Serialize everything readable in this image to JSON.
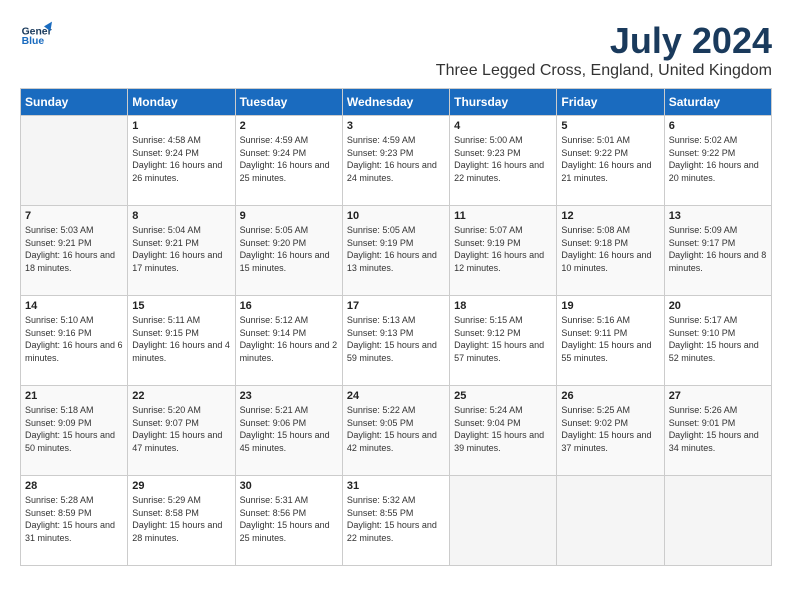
{
  "header": {
    "logo_line1": "General",
    "logo_line2": "Blue",
    "month_title": "July 2024",
    "location": "Three Legged Cross, England, United Kingdom"
  },
  "days_of_week": [
    "Sunday",
    "Monday",
    "Tuesday",
    "Wednesday",
    "Thursday",
    "Friday",
    "Saturday"
  ],
  "weeks": [
    [
      {
        "day": "",
        "sunrise": "",
        "sunset": "",
        "daylight": ""
      },
      {
        "day": "1",
        "sunrise": "Sunrise: 4:58 AM",
        "sunset": "Sunset: 9:24 PM",
        "daylight": "Daylight: 16 hours and 26 minutes."
      },
      {
        "day": "2",
        "sunrise": "Sunrise: 4:59 AM",
        "sunset": "Sunset: 9:24 PM",
        "daylight": "Daylight: 16 hours and 25 minutes."
      },
      {
        "day": "3",
        "sunrise": "Sunrise: 4:59 AM",
        "sunset": "Sunset: 9:23 PM",
        "daylight": "Daylight: 16 hours and 24 minutes."
      },
      {
        "day": "4",
        "sunrise": "Sunrise: 5:00 AM",
        "sunset": "Sunset: 9:23 PM",
        "daylight": "Daylight: 16 hours and 22 minutes."
      },
      {
        "day": "5",
        "sunrise": "Sunrise: 5:01 AM",
        "sunset": "Sunset: 9:22 PM",
        "daylight": "Daylight: 16 hours and 21 minutes."
      },
      {
        "day": "6",
        "sunrise": "Sunrise: 5:02 AM",
        "sunset": "Sunset: 9:22 PM",
        "daylight": "Daylight: 16 hours and 20 minutes."
      }
    ],
    [
      {
        "day": "7",
        "sunrise": "Sunrise: 5:03 AM",
        "sunset": "Sunset: 9:21 PM",
        "daylight": "Daylight: 16 hours and 18 minutes."
      },
      {
        "day": "8",
        "sunrise": "Sunrise: 5:04 AM",
        "sunset": "Sunset: 9:21 PM",
        "daylight": "Daylight: 16 hours and 17 minutes."
      },
      {
        "day": "9",
        "sunrise": "Sunrise: 5:05 AM",
        "sunset": "Sunset: 9:20 PM",
        "daylight": "Daylight: 16 hours and 15 minutes."
      },
      {
        "day": "10",
        "sunrise": "Sunrise: 5:05 AM",
        "sunset": "Sunset: 9:19 PM",
        "daylight": "Daylight: 16 hours and 13 minutes."
      },
      {
        "day": "11",
        "sunrise": "Sunrise: 5:07 AM",
        "sunset": "Sunset: 9:19 PM",
        "daylight": "Daylight: 16 hours and 12 minutes."
      },
      {
        "day": "12",
        "sunrise": "Sunrise: 5:08 AM",
        "sunset": "Sunset: 9:18 PM",
        "daylight": "Daylight: 16 hours and 10 minutes."
      },
      {
        "day": "13",
        "sunrise": "Sunrise: 5:09 AM",
        "sunset": "Sunset: 9:17 PM",
        "daylight": "Daylight: 16 hours and 8 minutes."
      }
    ],
    [
      {
        "day": "14",
        "sunrise": "Sunrise: 5:10 AM",
        "sunset": "Sunset: 9:16 PM",
        "daylight": "Daylight: 16 hours and 6 minutes."
      },
      {
        "day": "15",
        "sunrise": "Sunrise: 5:11 AM",
        "sunset": "Sunset: 9:15 PM",
        "daylight": "Daylight: 16 hours and 4 minutes."
      },
      {
        "day": "16",
        "sunrise": "Sunrise: 5:12 AM",
        "sunset": "Sunset: 9:14 PM",
        "daylight": "Daylight: 16 hours and 2 minutes."
      },
      {
        "day": "17",
        "sunrise": "Sunrise: 5:13 AM",
        "sunset": "Sunset: 9:13 PM",
        "daylight": "Daylight: 15 hours and 59 minutes."
      },
      {
        "day": "18",
        "sunrise": "Sunrise: 5:15 AM",
        "sunset": "Sunset: 9:12 PM",
        "daylight": "Daylight: 15 hours and 57 minutes."
      },
      {
        "day": "19",
        "sunrise": "Sunrise: 5:16 AM",
        "sunset": "Sunset: 9:11 PM",
        "daylight": "Daylight: 15 hours and 55 minutes."
      },
      {
        "day": "20",
        "sunrise": "Sunrise: 5:17 AM",
        "sunset": "Sunset: 9:10 PM",
        "daylight": "Daylight: 15 hours and 52 minutes."
      }
    ],
    [
      {
        "day": "21",
        "sunrise": "Sunrise: 5:18 AM",
        "sunset": "Sunset: 9:09 PM",
        "daylight": "Daylight: 15 hours and 50 minutes."
      },
      {
        "day": "22",
        "sunrise": "Sunrise: 5:20 AM",
        "sunset": "Sunset: 9:07 PM",
        "daylight": "Daylight: 15 hours and 47 minutes."
      },
      {
        "day": "23",
        "sunrise": "Sunrise: 5:21 AM",
        "sunset": "Sunset: 9:06 PM",
        "daylight": "Daylight: 15 hours and 45 minutes."
      },
      {
        "day": "24",
        "sunrise": "Sunrise: 5:22 AM",
        "sunset": "Sunset: 9:05 PM",
        "daylight": "Daylight: 15 hours and 42 minutes."
      },
      {
        "day": "25",
        "sunrise": "Sunrise: 5:24 AM",
        "sunset": "Sunset: 9:04 PM",
        "daylight": "Daylight: 15 hours and 39 minutes."
      },
      {
        "day": "26",
        "sunrise": "Sunrise: 5:25 AM",
        "sunset": "Sunset: 9:02 PM",
        "daylight": "Daylight: 15 hours and 37 minutes."
      },
      {
        "day": "27",
        "sunrise": "Sunrise: 5:26 AM",
        "sunset": "Sunset: 9:01 PM",
        "daylight": "Daylight: 15 hours and 34 minutes."
      }
    ],
    [
      {
        "day": "28",
        "sunrise": "Sunrise: 5:28 AM",
        "sunset": "Sunset: 8:59 PM",
        "daylight": "Daylight: 15 hours and 31 minutes."
      },
      {
        "day": "29",
        "sunrise": "Sunrise: 5:29 AM",
        "sunset": "Sunset: 8:58 PM",
        "daylight": "Daylight: 15 hours and 28 minutes."
      },
      {
        "day": "30",
        "sunrise": "Sunrise: 5:31 AM",
        "sunset": "Sunset: 8:56 PM",
        "daylight": "Daylight: 15 hours and 25 minutes."
      },
      {
        "day": "31",
        "sunrise": "Sunrise: 5:32 AM",
        "sunset": "Sunset: 8:55 PM",
        "daylight": "Daylight: 15 hours and 22 minutes."
      },
      {
        "day": "",
        "sunrise": "",
        "sunset": "",
        "daylight": ""
      },
      {
        "day": "",
        "sunrise": "",
        "sunset": "",
        "daylight": ""
      },
      {
        "day": "",
        "sunrise": "",
        "sunset": "",
        "daylight": ""
      }
    ]
  ]
}
